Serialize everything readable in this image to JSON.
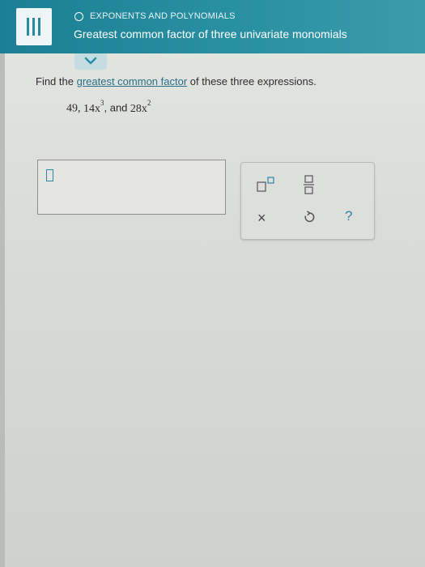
{
  "header": {
    "topic": "EXPONENTS AND POLYNOMIALS",
    "title": "Greatest common factor of three univariate monomials",
    "menu_icon": "hamburger-icon",
    "topic_icon": "circle-icon"
  },
  "question": {
    "prefix": "Find the ",
    "link": "greatest common factor",
    "suffix": " of these three expressions.",
    "expr": {
      "a": "49,",
      "b_coef": "14x",
      "b_exp": "3",
      "sep": ", and",
      "c_coef": "28x",
      "c_exp": "2"
    }
  },
  "answer": {
    "value": ""
  },
  "keypad": {
    "icons": [
      "exponent-template-icon",
      "fraction-template-icon",
      "clear-icon",
      "undo-icon",
      "help-icon"
    ],
    "clear_symbol": "×",
    "help_symbol": "?"
  },
  "colors": {
    "header": "#2a91a3",
    "link": "#2a6f86",
    "accent": "#2b87a8"
  }
}
